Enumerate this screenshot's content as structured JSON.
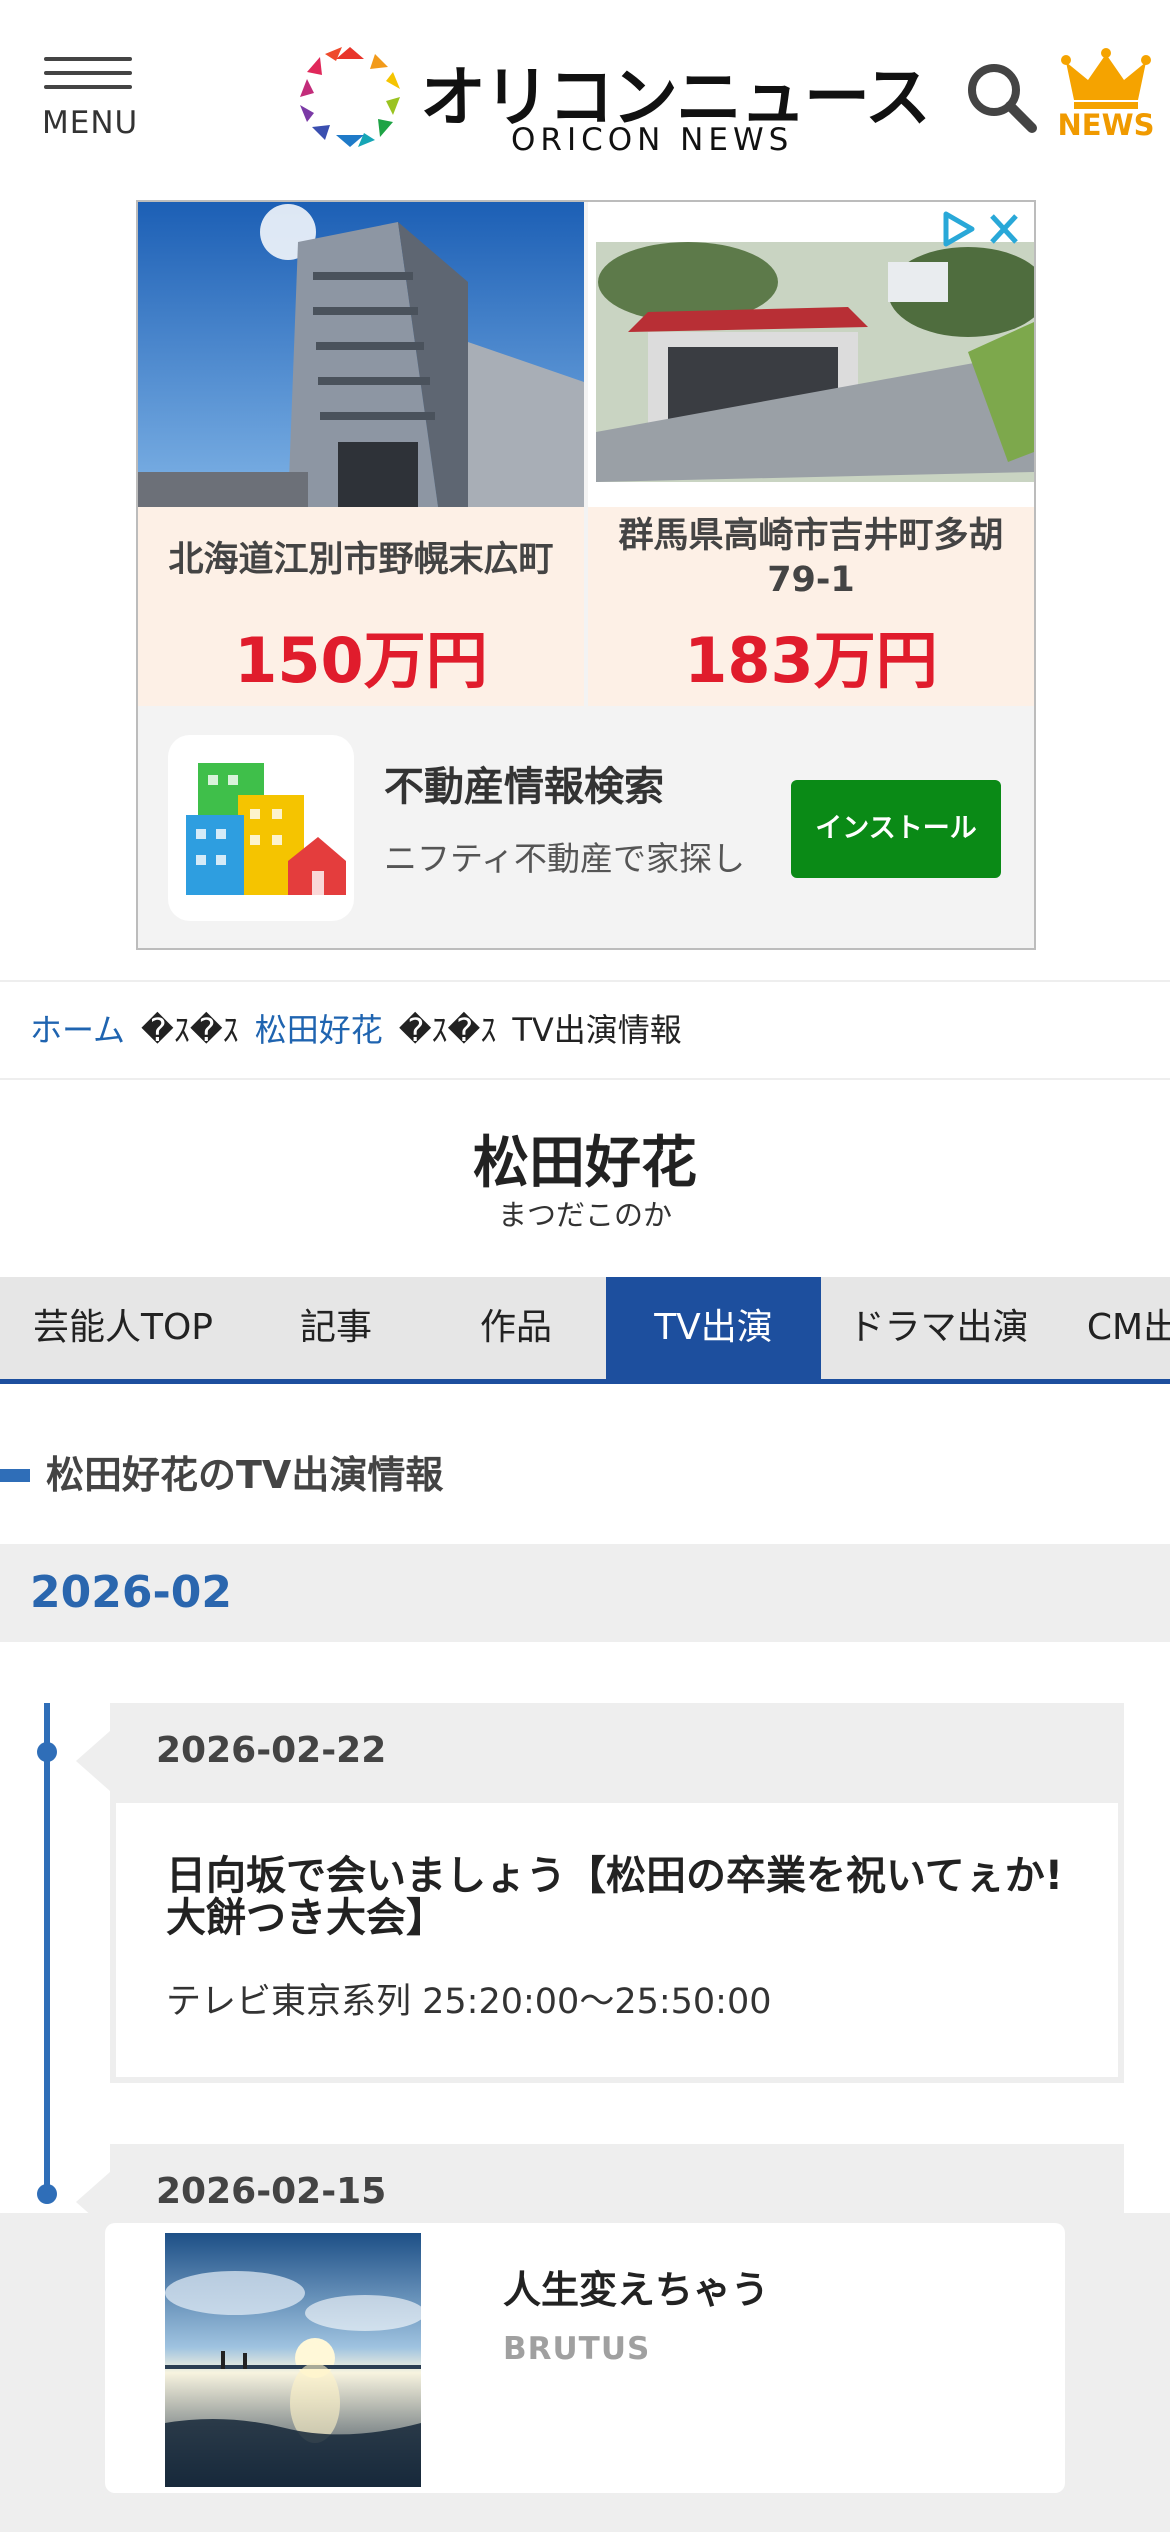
{
  "header": {
    "menu_label": "MENU",
    "logo_title": "オリコンニュース",
    "logo_subtitle": "ORICON NEWS",
    "news_label": "NEWS"
  },
  "ad": {
    "cards": [
      {
        "address": "北海道江別市野幌末広町",
        "price": "150万円"
      },
      {
        "address": "群馬県高崎市吉井町多胡 79-1",
        "price": "183万円"
      }
    ],
    "app_title": "不動産情報検索",
    "app_desc": "ニフティ不動産で家探し",
    "install_label": "インストール"
  },
  "breadcrumb": {
    "home": "ホーム",
    "sep": "�ｽ�ｽ",
    "person": "松田好花",
    "current": "TV出演情報"
  },
  "person": {
    "name": "松田好花",
    "kana": "まつだこのか"
  },
  "tabs": [
    {
      "label": "芸能人TOP",
      "active": false
    },
    {
      "label": "記事",
      "active": false
    },
    {
      "label": "作品",
      "active": false
    },
    {
      "label": "TV出演",
      "active": true
    },
    {
      "label": "ドラマ出演",
      "active": false
    },
    {
      "label": "CM出演",
      "active": false
    }
  ],
  "section_title": "松田好花のTV出演情報",
  "month": "2026-02",
  "entries": [
    {
      "date": "2026-02-22",
      "title": "日向坂で会いましょう【松田の卒業を祝いてぇか!大餅つき大会】",
      "channel_time": "テレビ東京系列 25:20:00～25:50:00"
    },
    {
      "date": "2026-02-15"
    }
  ],
  "bottom_ad": {
    "title": "人生変えちゃう",
    "subtitle": "BRUTUS"
  },
  "colors": {
    "accent_blue": "#1d4f9e",
    "link_blue": "#1f64b0",
    "price_red": "#e01c2c",
    "install_green": "#0a8a16",
    "crown_orange": "#f09a00"
  }
}
